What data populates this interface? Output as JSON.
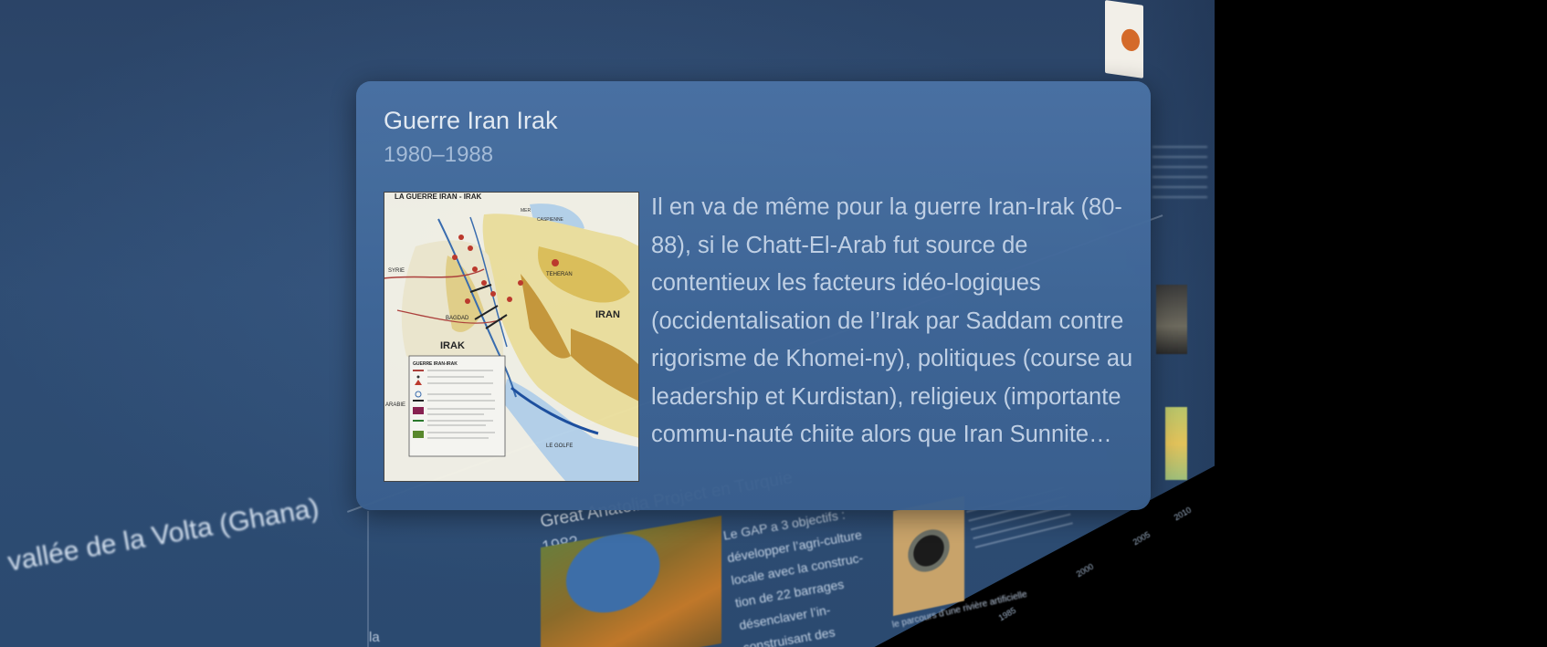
{
  "popup": {
    "title": "Guerre Iran Irak",
    "date": "1980–1988",
    "description": "Il en va de même pour la guerre Iran-Irak (80-88), si le Chatt-El-Arab fut source de contentieux les facteurs idéo-logiques (occidentalisation de l’Irak par Saddam contre rigorisme de Khomei-ny), politiques (course au leadership et Kurdistan), religieux (importante commu-nauté chiite alors que Iran Sunnite…",
    "map": {
      "title": "LA GUERRE IRAN - IRAK",
      "labels": {
        "mer": "MER",
        "caspienne": "CASPIENNE",
        "teheran": "TEHERAN",
        "iran": "IRAN",
        "irak": "IRAK",
        "syrie": "SYRIE",
        "arabie": "ARABIE",
        "bagdad": "BAGDAD",
        "golfe": "LE GOLFE"
      },
      "legend_title": "GUERRE IRAN-IRAK"
    }
  },
  "background": {
    "left_event_title": "vallée de la Volta (Ghana)",
    "left_event_suffix": "la",
    "bottom_event_title": "Great Anatolia Project en Turquie",
    "bottom_event_date": "1982",
    "bottom_event_text": "Le GAP a 3 objectifs : développer l’agri-culture locale avec la construc-tion de 22 barrages désenclaver l’in-construisant des",
    "tube_caption": "le parcours d’une rivière artificielle",
    "years": [
      "1985",
      "2000",
      "2005",
      "2010"
    ]
  }
}
